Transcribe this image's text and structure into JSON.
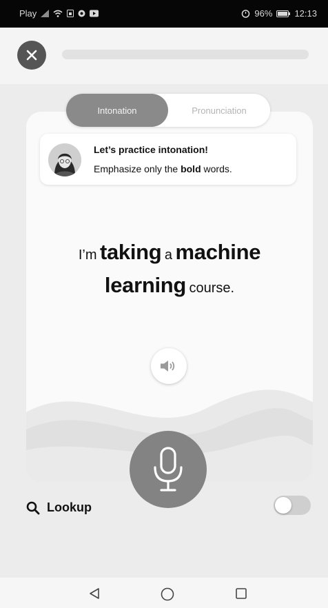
{
  "status_bar": {
    "carrier": "Play",
    "battery": "96%",
    "time": "12:13",
    "icons": [
      "signal-icon",
      "wifi-icon",
      "sim-icon",
      "app-icon",
      "media-icon",
      "alarm-icon",
      "battery-icon"
    ]
  },
  "lesson": {
    "progress": 0.0,
    "close_icon": "close-icon"
  },
  "tabs": [
    {
      "label": "Intonation",
      "active": true
    },
    {
      "label": "Pronunciation",
      "active": false
    }
  ],
  "instruction": {
    "title": "Let’s practice intonation!",
    "body_before": "Emphasize only the ",
    "body_bold": "bold",
    "body_after": " words."
  },
  "sentence": {
    "words": [
      {
        "text": "I’m",
        "bold": false
      },
      {
        "text": "taking",
        "bold": true
      },
      {
        "text": "a",
        "bold": false
      },
      {
        "text": "machine",
        "bold": true
      },
      {
        "text": "learning",
        "bold": true
      },
      {
        "text": "course.",
        "bold": false
      }
    ]
  },
  "audio": {
    "icon": "speaker-icon"
  },
  "mic": {
    "icon": "microphone-icon"
  },
  "lookup": {
    "label": "Lookup",
    "icon": "search-icon",
    "toggle_on": false
  },
  "nav": {
    "icons": [
      "back-triangle-icon",
      "home-circle-icon",
      "recents-square-icon"
    ]
  },
  "colors": {
    "accent_gray": "#8a8a8a",
    "mic": "#838383",
    "background": "#ececec"
  }
}
